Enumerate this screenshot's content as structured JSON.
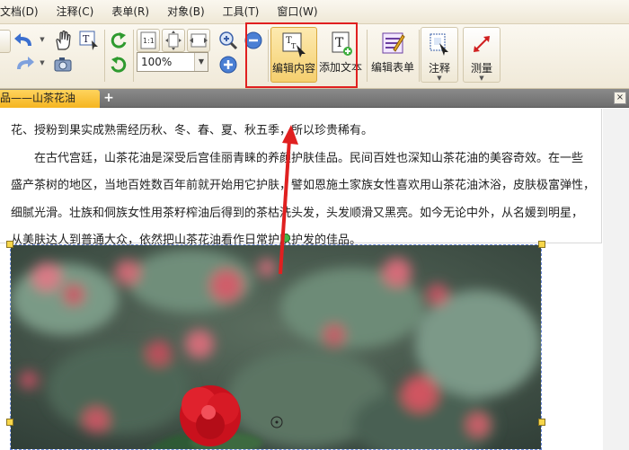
{
  "menu": [
    "文档(D)",
    "注释(C)",
    "表单(R)",
    "对象(B)",
    "工具(T)",
    "窗口(W)"
  ],
  "toolbar": {
    "zoom_value": "100%",
    "edit_content": "编辑内容",
    "add_text": "添加文本",
    "edit_form": "编辑表单",
    "annotate": "注释",
    "measure": "测量",
    "dropdown_glyph": "▼"
  },
  "tabs": {
    "active_title": "品——山茶花油",
    "add": "+",
    "close": "×"
  },
  "document": {
    "lines": [
      "花、授粉到果实成熟需经历秋、冬、春、夏、秋五季，所以珍贵稀有。",
      "在古代宫廷，山茶花油是深受后宫佳丽青睐的养颜护肤佳品。民间百姓也深知山茶花油的美容奇效。在一些",
      "盛产茶树的地区，当地百姓数百年前就开始用它护肤，譬如恩施土家族女性喜欢用山茶花油沐浴，皮肤极富弹性，",
      "细腻光滑。壮族和侗族女性用茶籽榨油后得到的茶枯洗头发，头发顺滑又黑亮。如今无论中外，从名媛到明星，",
      "从美肤达人到普通大众，依然把山茶花油看作日常护肤护发的佳品。"
    ]
  },
  "colors": {
    "highlight_box": "#e02020",
    "arrow": "#e02020",
    "active_tab": "#f5b520"
  }
}
